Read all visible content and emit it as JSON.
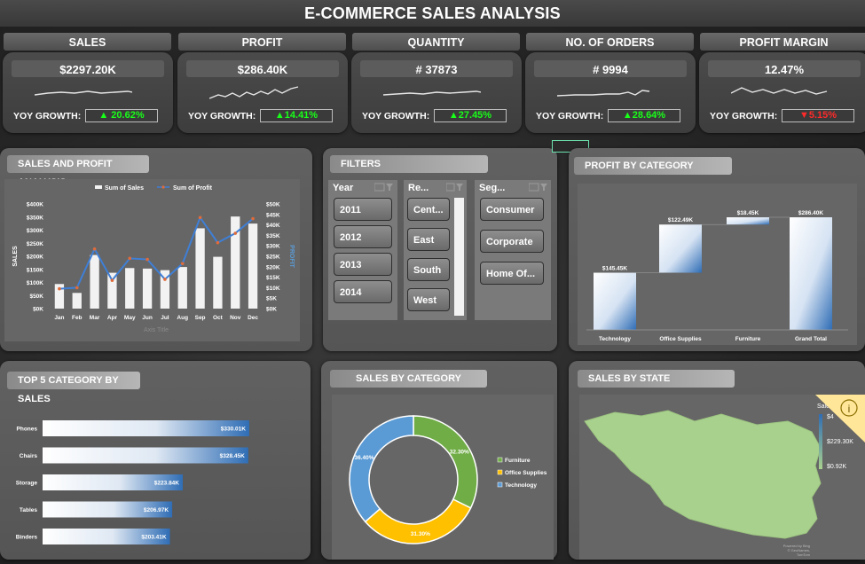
{
  "title": "E-COMMERCE SALES ANALYSIS",
  "kpis": [
    {
      "label": "SALES",
      "value": "$2297.20K",
      "yoy_label": "YOY GROWTH:",
      "yoy": "▲ 20.62%",
      "direction": "up"
    },
    {
      "label": "PROFIT",
      "value": "$286.40K",
      "yoy_label": "YOY GROWTH:",
      "yoy": "▲14.41%",
      "direction": "up"
    },
    {
      "label": "QUANTITY",
      "value": "# 37873",
      "yoy_label": "YOY GROWTH:",
      "yoy": "▲27.45%",
      "direction": "up"
    },
    {
      "label": "NO. OF ORDERS",
      "value": "# 9994",
      "yoy_label": "YOY GROWTH:",
      "yoy": "▲28.64%",
      "direction": "up"
    },
    {
      "label": "PROFIT MARGIN",
      "value": "12.47%",
      "yoy_label": "YOY GROWTH:",
      "yoy": "▼5.15%",
      "direction": "down"
    }
  ],
  "panels": {
    "sales_profit": "SALES AND PROFIT ANALYSIS",
    "filters": "FILTERS",
    "profit_by_category": "PROFIT BY CATEGORY",
    "top5": "TOP 5 CATEGORY BY SALES",
    "sales_by_category": "SALES BY CATEGORY",
    "sales_by_state": "SALES BY STATE"
  },
  "filters": {
    "year": {
      "title": "Year",
      "items": [
        "2011",
        "2012",
        "2013",
        "2014"
      ]
    },
    "region": {
      "title": "Re...",
      "items": [
        "Cent...",
        "East",
        "South",
        "West"
      ]
    },
    "segment": {
      "title": "Seg...",
      "items": [
        "Consumer",
        "Corporate",
        "Home Of..."
      ]
    }
  },
  "colors": {
    "up": "#19ff19",
    "down": "#ff2a2a",
    "accent_blue": "#2f6db5",
    "line_blue": "#3f7fd6",
    "furniture": "#70ad47",
    "office_supplies": "#ffc000",
    "technology": "#5b9bd5"
  },
  "chart_data": [
    {
      "type": "bar",
      "name": "sales_and_profit",
      "categories": [
        "Jan",
        "Feb",
        "Mar",
        "Apr",
        "May",
        "Jun",
        "Jul",
        "Aug",
        "Sep",
        "Oct",
        "Nov",
        "Dec"
      ],
      "series": [
        {
          "name": "Sum of Sales",
          "type": "bar",
          "axis": "left",
          "values": [
            94000,
            60000,
            205000,
            137000,
            155000,
            153000,
            147000,
            159000,
            307000,
            198000,
            352000,
            325000
          ]
        },
        {
          "name": "Sum of Profit",
          "type": "line",
          "axis": "right",
          "values": [
            9500,
            10000,
            28500,
            13500,
            24000,
            23500,
            14000,
            21500,
            43500,
            31500,
            36000,
            43000
          ]
        }
      ],
      "left_ticks": [
        "$0K",
        "$50K",
        "$100K",
        "$150K",
        "$200K",
        "$250K",
        "$300K",
        "$350K",
        "$400K"
      ],
      "right_ticks": [
        "$0K",
        "$5K",
        "$10K",
        "$15K",
        "$20K",
        "$25K",
        "$30K",
        "$35K",
        "$40K",
        "$45K",
        "$50K"
      ],
      "ylim_left": [
        0,
        400000
      ],
      "ylim_right": [
        0,
        50000
      ],
      "ylabel": "SALES",
      "y2label": "PROFIT",
      "xlabel": "Axis Title",
      "legend": "top"
    },
    {
      "type": "bar",
      "name": "profit_by_category_waterfall",
      "categories": [
        "Technology",
        "Office Supplies",
        "Furniture",
        "Grand Total"
      ],
      "values": [
        145.45,
        122.49,
        18.45,
        286.4
      ],
      "labels": [
        "$145.45K",
        "$122.49K",
        "$18.45K",
        "$286.40K"
      ],
      "unit": "K",
      "ylim": [
        0,
        300
      ]
    },
    {
      "type": "bar",
      "name": "top5_category_by_sales",
      "orientation": "horizontal",
      "categories": [
        "Phones",
        "Chairs",
        "Storage",
        "Tables",
        "Binders"
      ],
      "values": [
        330.01,
        328.45,
        223.84,
        206.97,
        203.41
      ],
      "labels": [
        "$330.01K",
        "$328.45K",
        "$223.84K",
        "$206.97K",
        "$203.41K"
      ],
      "xlim": [
        0,
        340
      ]
    },
    {
      "type": "pie",
      "name": "sales_by_category",
      "style": "donut",
      "categories": [
        "Furniture",
        "Office Supplies",
        "Technology"
      ],
      "values": [
        32.3,
        31.3,
        36.4
      ],
      "labels": [
        "32.30%",
        "31.30%",
        "36.40%"
      ],
      "legend": "right"
    }
  ],
  "map": {
    "legend_title": "Sales",
    "legend_max": "$4",
    "legend_mid": "$229.30K",
    "legend_min": "$0.92K",
    "info_icon": "i",
    "credit_line1": "Powered by Bing",
    "credit_line2": "© GeoNames, TomTom"
  }
}
